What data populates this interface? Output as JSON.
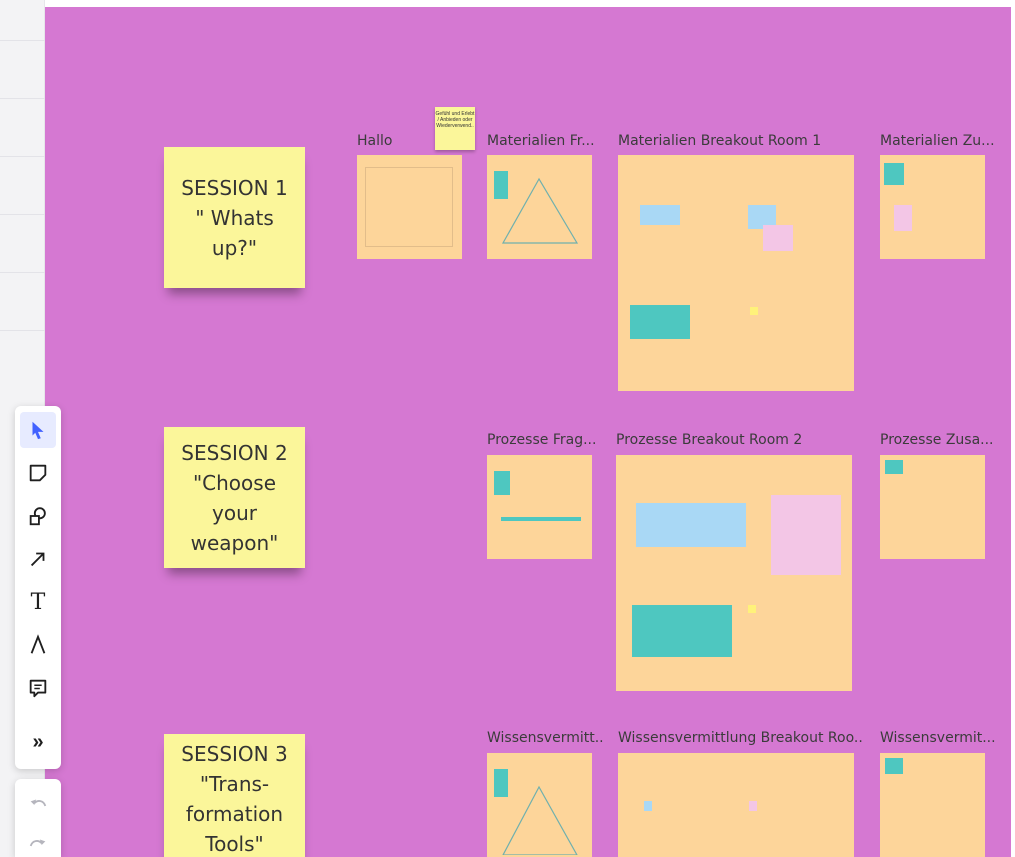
{
  "sessions": [
    {
      "lines": [
        "SESSION 1",
        "\" Whats",
        "up?\""
      ]
    },
    {
      "lines": [
        "SESSION 2",
        "\"Choose",
        "your",
        "weapon\""
      ]
    },
    {
      "lines": [
        "SESSION 3",
        "\"Trans-",
        "formation",
        "Tools\""
      ]
    }
  ],
  "frames": {
    "hallo": "Hallo",
    "mat_fragen": "Materialien Fr...",
    "mat_breakout": "Materialien Breakout Room 1",
    "mat_zus": "Materialien Zu...",
    "proz_fragen": "Prozesse Frag...",
    "proz_breakout": "Prozesse Breakout Room 2",
    "proz_zus": "Prozesse Zusa...",
    "wiss_fragen": "Wissensvermitt...",
    "wiss_breakout": "Wissensvermittlung Breakout Roo...",
    "wiss_zus": "Wissensvermit..."
  },
  "floating_note": "Gefühl und Erlebt / Anbieden oder Wiederverwend..",
  "toolbar": {
    "tools": [
      "select",
      "sticky-note",
      "shapes",
      "arrow",
      "text",
      "pen",
      "comment",
      "more"
    ],
    "more_label": "»"
  },
  "colors": {
    "canvas": "#d578d2",
    "frame": "#fdd59a",
    "sticky": "#fbf69a",
    "teal": "#4ec7c0",
    "accent": "#4262ff"
  }
}
